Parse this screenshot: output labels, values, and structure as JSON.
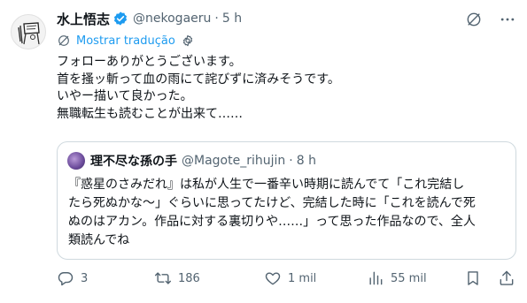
{
  "author": {
    "name": "水上悟志",
    "handle": "@nekogaeru",
    "separator": "·",
    "time": "5 h"
  },
  "translate": {
    "label": "Mostrar tradução"
  },
  "tweet": {
    "lines": [
      "フォローありがとうございます。",
      "首を搔ッ斬って血の雨にて詫びずに済みそうです。",
      "いやー描いて良かった。",
      "無職転生も読むことが出来て……"
    ]
  },
  "quote": {
    "name": "理不尽な孫の手",
    "handle": "@Magote_rihujin",
    "separator": "·",
    "time": "8 h",
    "lines": [
      "『惑星のさみだれ』は私が人生で一番辛い時期に読んでて「これ完結し",
      "たら死ぬかな〜」ぐらいに思ってたけど、完結した時に「これを読んで死",
      "ぬのはアカン。作品に対する裏切りや……」って思った作品なので、全人",
      "類読んでね"
    ]
  },
  "actions": {
    "replies": "3",
    "reposts": "186",
    "likes": "1 mil",
    "views": "55 mil"
  },
  "colors": {
    "accent": "#1d9bf0",
    "secondary_text": "#536471",
    "border": "#cfd9de"
  }
}
